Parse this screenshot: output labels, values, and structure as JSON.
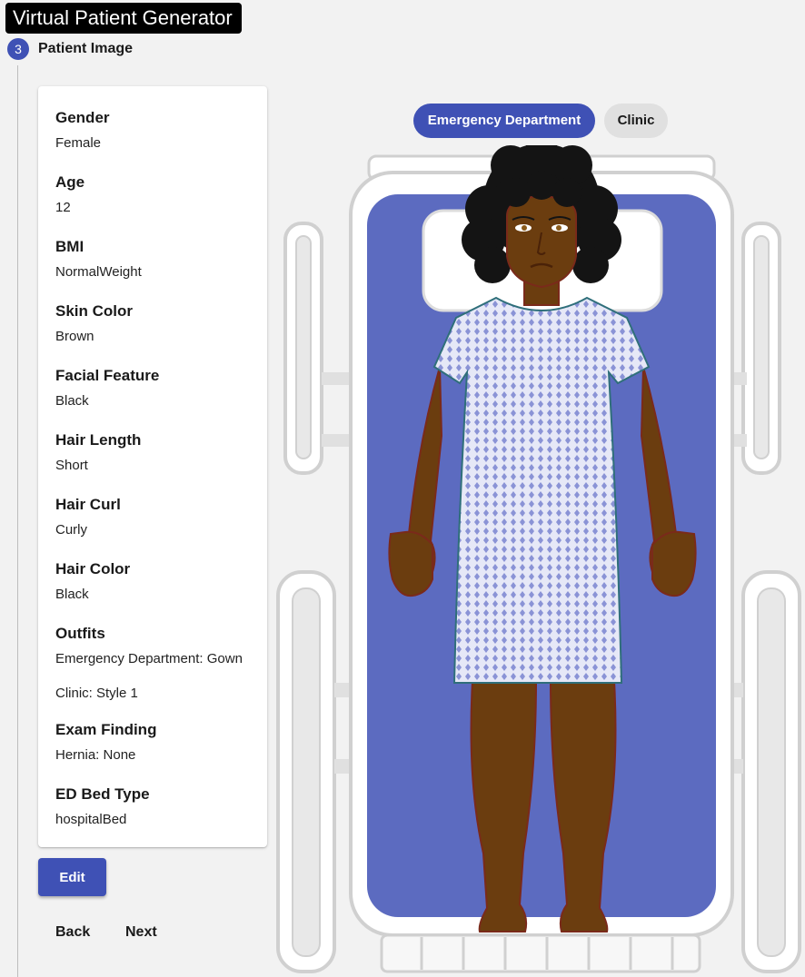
{
  "app": {
    "title": "Virtual Patient Generator"
  },
  "step": {
    "number": "3",
    "label": "Patient Image"
  },
  "attributes": [
    {
      "label": "Gender",
      "value": "Female"
    },
    {
      "label": "Age",
      "value": "12"
    },
    {
      "label": "BMI",
      "value": "NormalWeight"
    },
    {
      "label": "Skin Color",
      "value": "Brown"
    },
    {
      "label": "Facial Feature",
      "value": "Black"
    },
    {
      "label": "Hair Length",
      "value": "Short"
    },
    {
      "label": "Hair Curl",
      "value": "Curly"
    },
    {
      "label": "Hair Color",
      "value": "Black"
    }
  ],
  "outfits": {
    "label": "Outfits",
    "values": [
      "Emergency Department: Gown",
      "Clinic: Style 1"
    ]
  },
  "exam_finding": {
    "label": "Exam Finding",
    "value": "Hernia: None"
  },
  "bed_type": {
    "label": "ED Bed Type",
    "value": "hospitalBed"
  },
  "actions": {
    "edit": "Edit",
    "back": "Back",
    "next": "Next"
  },
  "tabs": [
    {
      "label": "Emergency Department",
      "active": true
    },
    {
      "label": "Clinic",
      "active": false
    }
  ],
  "colors": {
    "primary": "#3f51b5",
    "mattress": "#5c6bc0",
    "skin": "#6b3d0f",
    "skin_outline": "#7a2a1a",
    "hair": "#141414",
    "gown": "#e6e8f7",
    "gown_pattern": "#8a93d6"
  }
}
